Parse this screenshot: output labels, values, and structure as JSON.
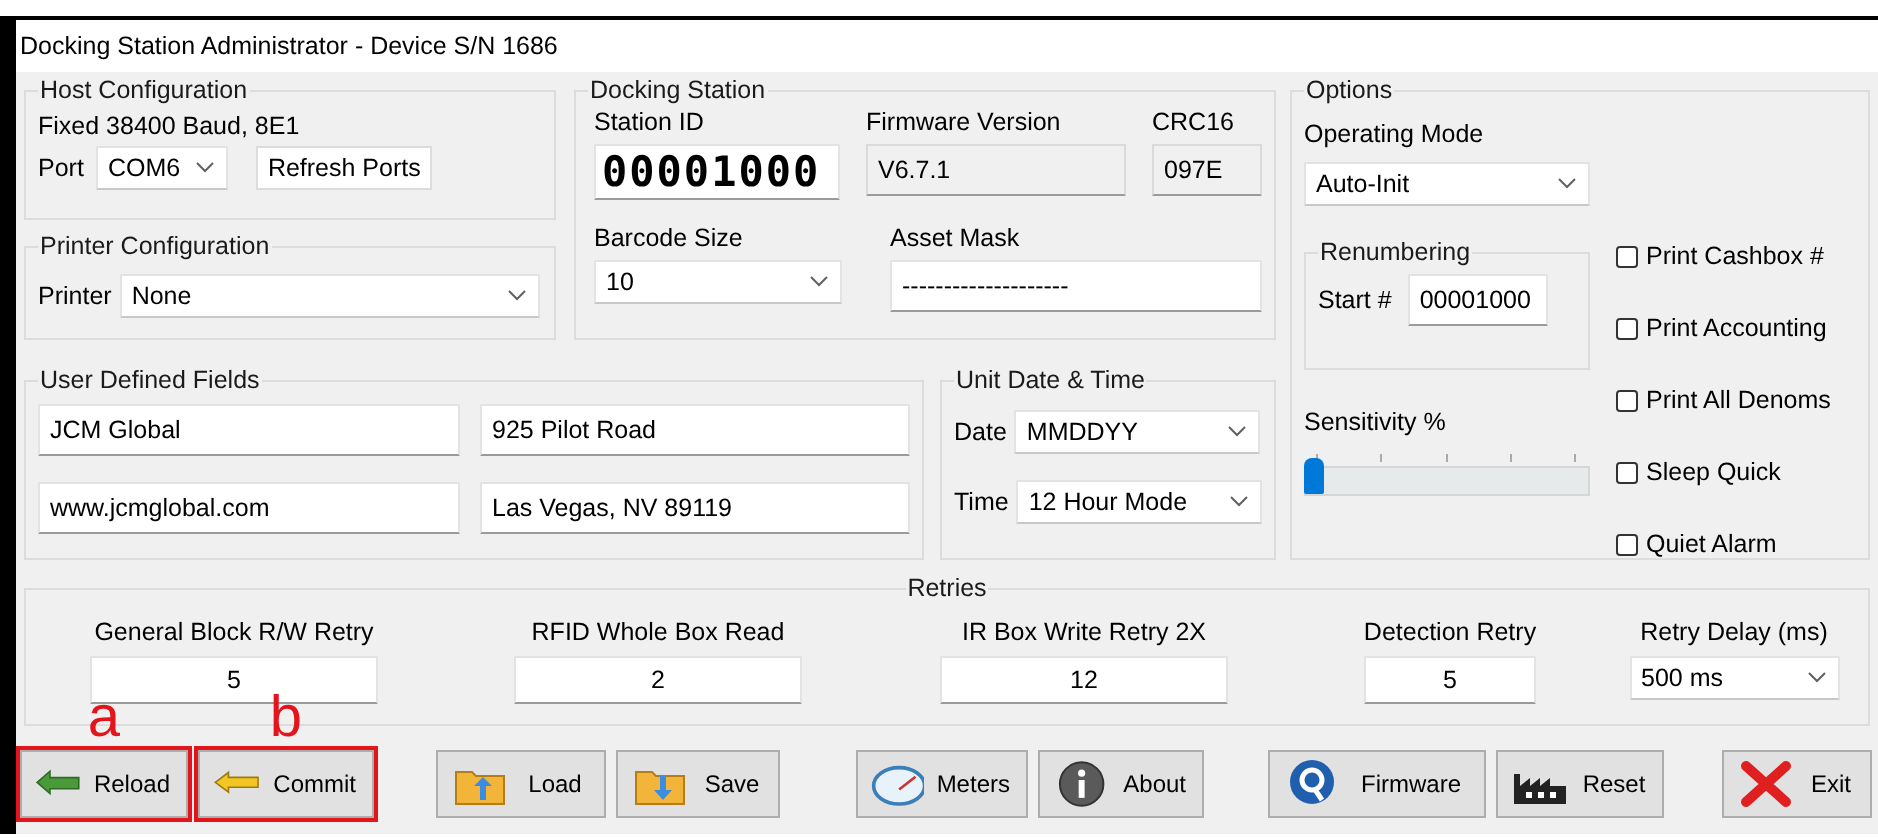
{
  "window": {
    "title": "Docking Station Administrator - Device S/N 1686"
  },
  "host_configuration": {
    "title": "Host Configuration",
    "baud": "Fixed 38400 Baud, 8E1",
    "port": {
      "label": "Port",
      "value": "COM6"
    },
    "refresh_button": "Refresh Ports"
  },
  "printer_configuration": {
    "title": "Printer Configuration",
    "printer": {
      "label": "Printer",
      "value": "None"
    }
  },
  "docking_station": {
    "title": "Docking Station",
    "station_id": {
      "label": "Station ID",
      "value": "00001000"
    },
    "firmware_version": {
      "label": "Firmware Version",
      "value": "V6.7.1"
    },
    "crc16": {
      "label": "CRC16",
      "value": "097E"
    },
    "barcode_size": {
      "label": "Barcode Size",
      "value": "10"
    },
    "asset_mask": {
      "label": "Asset Mask",
      "value": "--------------------"
    }
  },
  "user_defined_fields": {
    "title": "User Defined Fields",
    "values": [
      "JCM Global",
      "925 Pilot Road",
      "www.jcmglobal.com",
      "Las Vegas, NV 89119"
    ]
  },
  "unit_date_time": {
    "title": "Unit Date & Time",
    "date": {
      "label": "Date",
      "value": "MMDDYY"
    },
    "time": {
      "label": "Time",
      "value": "12 Hour Mode"
    }
  },
  "options": {
    "title": "Options",
    "operating_mode": {
      "label": "Operating Mode",
      "value": "Auto-Init"
    },
    "renumbering": {
      "title": "Renumbering",
      "label": "Start #",
      "value": "00001000"
    },
    "sensitivity": {
      "label": "Sensitivity %",
      "level": 0
    },
    "checkboxes": [
      {
        "label": "Print Cashbox #",
        "checked": false
      },
      {
        "label": "Print Accounting",
        "checked": false
      },
      {
        "label": "Print All Denoms",
        "checked": false
      },
      {
        "label": "Sleep Quick",
        "checked": false
      },
      {
        "label": "Quiet Alarm",
        "checked": false
      }
    ]
  },
  "retries": {
    "title": "Retries",
    "fields": [
      {
        "label": "General Block R/W Retry",
        "value": "5",
        "kind": "text"
      },
      {
        "label": "RFID Whole Box Read",
        "value": "2",
        "kind": "text"
      },
      {
        "label": "IR Box Write Retry 2X",
        "value": "12",
        "kind": "text"
      },
      {
        "label": "Detection Retry",
        "value": "5",
        "kind": "text"
      },
      {
        "label": "Retry Delay (ms)",
        "value": "500 ms",
        "kind": "combo"
      }
    ]
  },
  "toolbar": [
    {
      "buttons": [
        {
          "label": "Reload",
          "callout": "a"
        },
        {
          "label": "Commit",
          "callout": "b"
        }
      ]
    },
    {
      "buttons": [
        {
          "label": "Load"
        },
        {
          "label": "Save"
        }
      ]
    },
    {
      "buttons": [
        {
          "label": "Meters"
        },
        {
          "label": "About"
        }
      ]
    },
    {
      "buttons": [
        {
          "label": "Firmware"
        },
        {
          "label": "Reset"
        }
      ]
    },
    {
      "buttons": [
        {
          "label": "Exit"
        }
      ]
    }
  ]
}
